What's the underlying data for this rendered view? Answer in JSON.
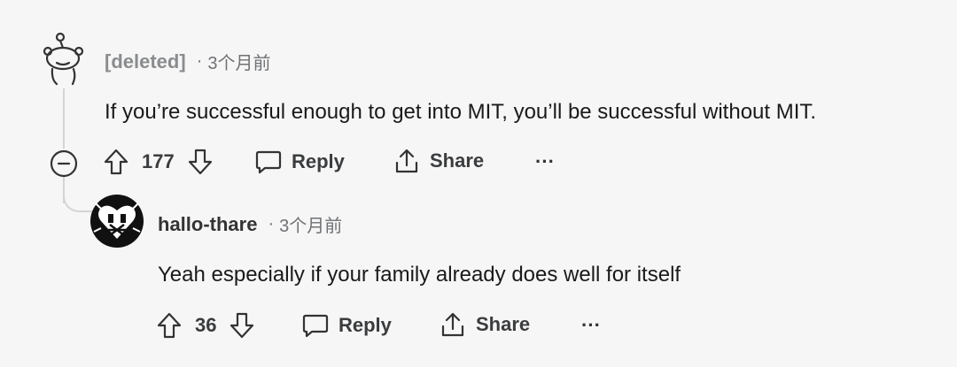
{
  "comment": {
    "author": "[deleted]",
    "time": "3个月前",
    "text": "If you’re successful enough to get into MIT, you’ll be successful without MIT.",
    "votes": "177",
    "reply_label": "Reply",
    "share_label": "Share",
    "more_label": "···",
    "avatar_icon": "deleted-snoo-icon"
  },
  "reply": {
    "author": "hallo-thare",
    "time": "3个月前",
    "text": "Yeah especially if your family already does well for itself",
    "votes": "36",
    "reply_label": "Reply",
    "share_label": "Share",
    "more_label": "···",
    "avatar_icon": "heart-avatar-icon"
  },
  "separator": "·"
}
